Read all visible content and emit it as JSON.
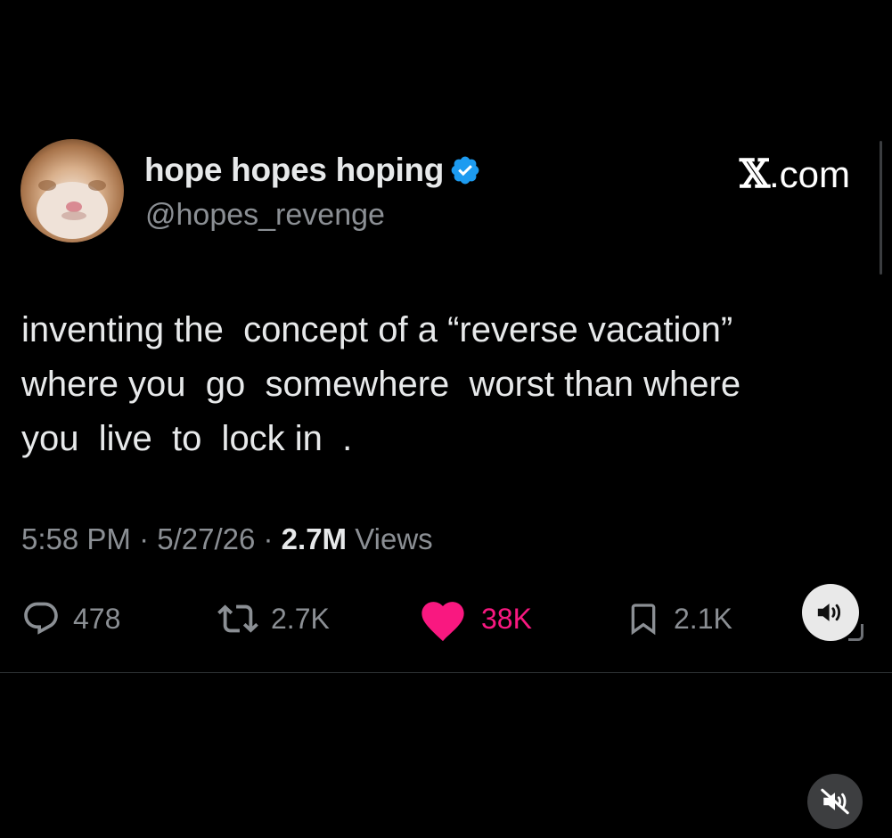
{
  "author": {
    "display_name": "hope hopes hoping",
    "handle": "@hopes_revenge",
    "verified": true,
    "verified_color": "#1d9bf0"
  },
  "brand": {
    "mark": "𝕏",
    "suffix": ".com"
  },
  "tweet": {
    "text": "inventing the  concept of a “reverse vacation”\nwhere you  go  somewhere  worst than where\nyou  live  to  lock in  ."
  },
  "meta": {
    "time": "5:58 PM",
    "date": "5/27/26",
    "separator": " · ",
    "views_count": "2.7M",
    "views_label": " Views"
  },
  "actions": {
    "replies": {
      "icon": "reply-icon",
      "count": "478"
    },
    "reposts": {
      "icon": "repost-icon",
      "count": "2.7K"
    },
    "likes": {
      "icon": "heart-icon",
      "count": "38K",
      "liked": true,
      "color": "#f91880"
    },
    "bookmarks": {
      "icon": "bookmark-icon",
      "count": "2.1K"
    }
  },
  "controls": {
    "sound_icon": "speaker-icon",
    "mute_icon": "speaker-muted-icon"
  }
}
